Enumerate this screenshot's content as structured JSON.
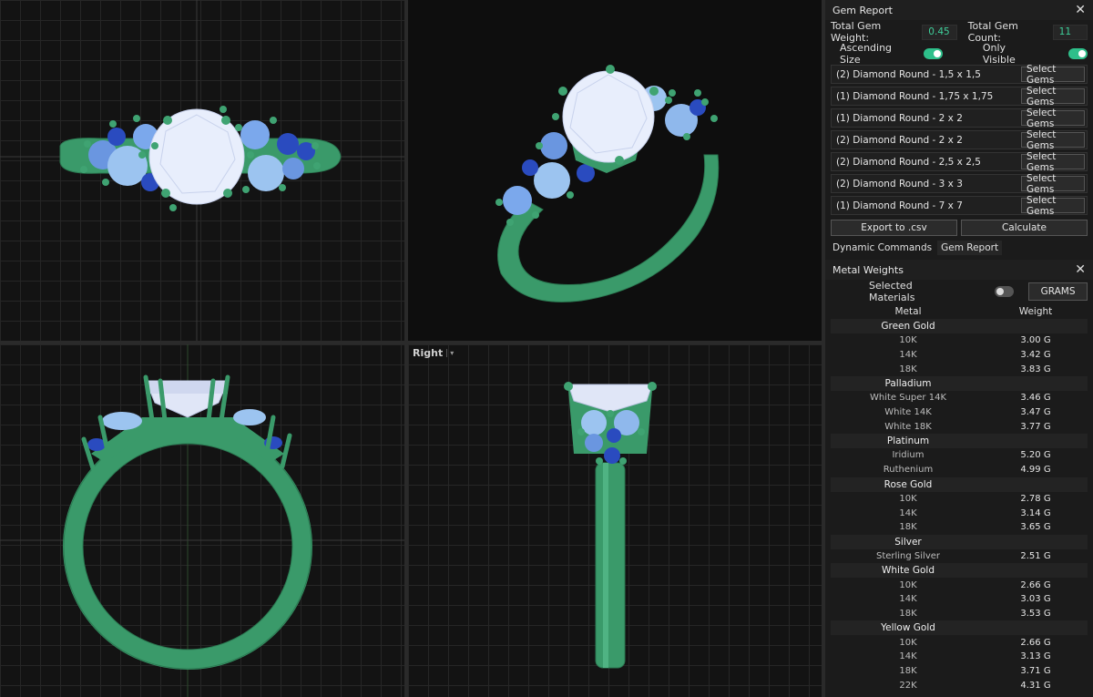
{
  "viewport_label": "Right",
  "gem_report": {
    "title": "Gem Report",
    "total_weight_label": "Total Gem Weight:",
    "total_weight_value": "0.45",
    "total_count_label": "Total Gem Count:",
    "total_count_value": "11",
    "ascending_label": "Ascending Size",
    "only_visible_label": "Only Visible",
    "gems": [
      "(2) Diamond Round - 1,5 x 1,5",
      "(1) Diamond Round - 1,75 x 1,75",
      "(1) Diamond Round - 2 x 2",
      "(2) Diamond Round - 2 x 2",
      "(2) Diamond Round - 2,5 x 2,5",
      "(2) Diamond Round - 3 x 3",
      "(1) Diamond Round - 7 x 7"
    ],
    "select_label": "Select Gems",
    "export_label": "Export to .csv",
    "calculate_label": "Calculate",
    "tabs": [
      "Dynamic Commands",
      "Gem Report"
    ]
  },
  "metal_weights": {
    "title": "Metal Weights",
    "selected_label": "Selected Materials",
    "unit_button": "GRAMS",
    "col_metal": "Metal",
    "col_weight": "Weight",
    "groups": [
      {
        "name": "Green Gold",
        "rows": [
          [
            "10K",
            "3.00 G"
          ],
          [
            "14K",
            "3.42 G"
          ],
          [
            "18K",
            "3.83 G"
          ]
        ]
      },
      {
        "name": "Palladium",
        "rows": [
          [
            "White Super 14K",
            "3.46 G"
          ],
          [
            "White 14K",
            "3.47 G"
          ],
          [
            "White 18K",
            "3.77 G"
          ]
        ]
      },
      {
        "name": "Platinum",
        "rows": [
          [
            "Iridium",
            "5.20 G"
          ],
          [
            "Ruthenium",
            "4.99 G"
          ]
        ]
      },
      {
        "name": "Rose Gold",
        "rows": [
          [
            "10K",
            "2.78 G"
          ],
          [
            "14K",
            "3.14 G"
          ],
          [
            "18K",
            "3.65 G"
          ]
        ]
      },
      {
        "name": "Silver",
        "rows": [
          [
            "Sterling Silver",
            "2.51 G"
          ]
        ]
      },
      {
        "name": "White Gold",
        "rows": [
          [
            "10K",
            "2.66 G"
          ],
          [
            "14K",
            "3.03 G"
          ],
          [
            "18K",
            "3.53 G"
          ]
        ]
      },
      {
        "name": "Yellow Gold",
        "rows": [
          [
            "10K",
            "2.66 G"
          ],
          [
            "14K",
            "3.13 G"
          ],
          [
            "18K",
            "3.71 G"
          ],
          [
            "22K",
            "4.31 G"
          ]
        ]
      }
    ]
  },
  "colors": {
    "metal": "#3a9a6a",
    "center_stone": "#e8eefc",
    "side_stone": "#9cc4f0",
    "sapphire": "#2a4bbf",
    "accent": "#2ebf8a"
  }
}
